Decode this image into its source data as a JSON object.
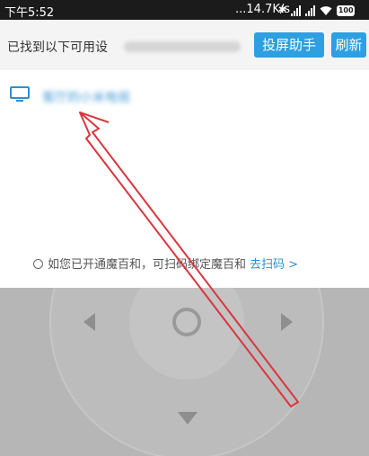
{
  "status_bar": {
    "time": "下午5:52",
    "speed": "...14.7K/s",
    "battery": "100"
  },
  "header": {
    "found_devices_label": "已找到以下可用设",
    "cast_helper_button": "投屏助手",
    "refresh_button": "刷新"
  },
  "device_list": [
    {
      "name": "客厅的小米电视",
      "icon": "tv-icon"
    }
  ],
  "magic_box": {
    "prompt": "如您已开通魔百和，可扫码绑定魔百和",
    "scan_link": "去扫码 >"
  },
  "colors": {
    "accent": "#2e9fe0",
    "link": "#2e8fd0",
    "annotation_arrow": "#d9363e",
    "remote_background": "#b6b6b6"
  }
}
